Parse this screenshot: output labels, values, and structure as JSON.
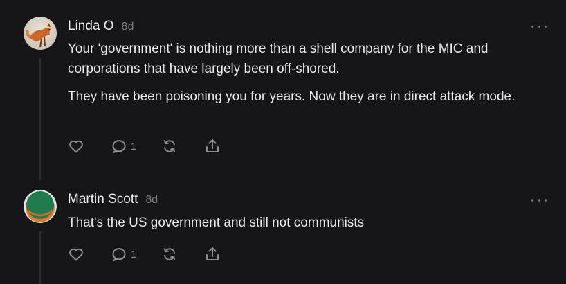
{
  "comments": [
    {
      "author": "Linda O",
      "age": "8d",
      "avatar_icon": "fox-avatar",
      "paragraphs": [
        "Your 'government' is nothing more than a shell company for the MIC and corporations that have largely been off-shored.",
        "They have been poisoning you for years. Now they are in direct attack mode."
      ],
      "reply_count": "1"
    },
    {
      "author": "Martin Scott",
      "age": "8d",
      "avatar_icon": "green-orange-circle-avatar",
      "paragraphs": [
        "That's the US government and still not communists"
      ],
      "reply_count": "1"
    }
  ],
  "icons": {
    "like": "heart-icon",
    "reply": "comment-bubble-icon",
    "restack": "restack-arrows-icon",
    "share": "share-upload-icon",
    "more": "more-dots-icon"
  },
  "colors": {
    "background": "#161618",
    "text": "#e9e9e9",
    "muted": "#8e8e93",
    "thread_line": "#2f2f33"
  }
}
